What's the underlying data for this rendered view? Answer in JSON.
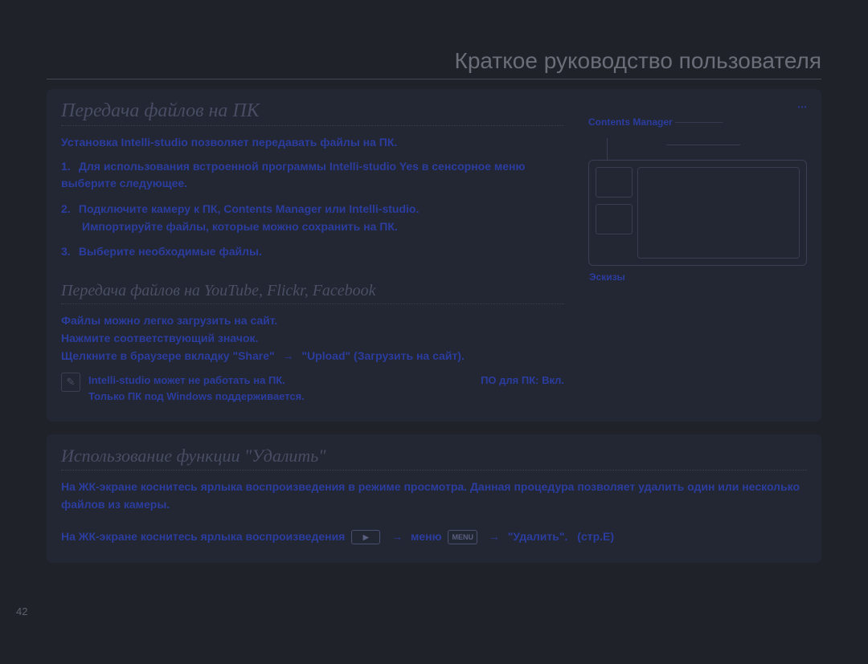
{
  "header": "Краткое руководство пользователя",
  "page_number": "42",
  "panel1": {
    "title": "Передача файлов на ПК",
    "intro": "Установка Intelli-studio позволяет передавать файлы на ПК.",
    "step1_pre": "1.",
    "step1": "Для использования встроенной программы Intelli-studio Yes в сенсорное меню выберите следующее.",
    "step2_pre": "2.",
    "step2": "Подключите камеру к ПК, Contents Manager или Intelli-studio.",
    "step2_sub": "Импортируйте файлы, которые можно сохранить на ПК.",
    "step3_pre": "3.",
    "step3": "Выберите необходимые файлы.",
    "section2_title": "Передача файлов на YouTube, Flickr, Facebook",
    "p_upload1": "Файлы можно легко загрузить на сайт.",
    "p_upload2": "Нажмите соответствующий значок.",
    "p_upload_action": "Щелкните в браузере вкладку \"Share\"",
    "p_upload_action2": "\"Upload\" (Загрузить на сайт).",
    "note1": "Intelli-studio может не работать на ПК.",
    "note2": "Только ПК под Windows поддерживается.",
    "note_right": "ПО для ПК: Вкл.",
    "right_label_top": "Contents Manager",
    "right_label_bottom": "Эскизы"
  },
  "panel2": {
    "title": "Использование функции \"Удалить\"",
    "p1": "На ЖК-экране коснитесь ярлыка воспроизведения в режиме просмотра. Данная процедура позволяет удалить один или несколько файлов из камеры.",
    "action_pre": "На ЖК-экране коснитесь ярлыка воспроизведения",
    "action_mid": "меню",
    "action_end": "\"Удалить\".",
    "action_suffix": "(стр.E)",
    "icon_play": "▶",
    "icon_menu": "MENU"
  }
}
